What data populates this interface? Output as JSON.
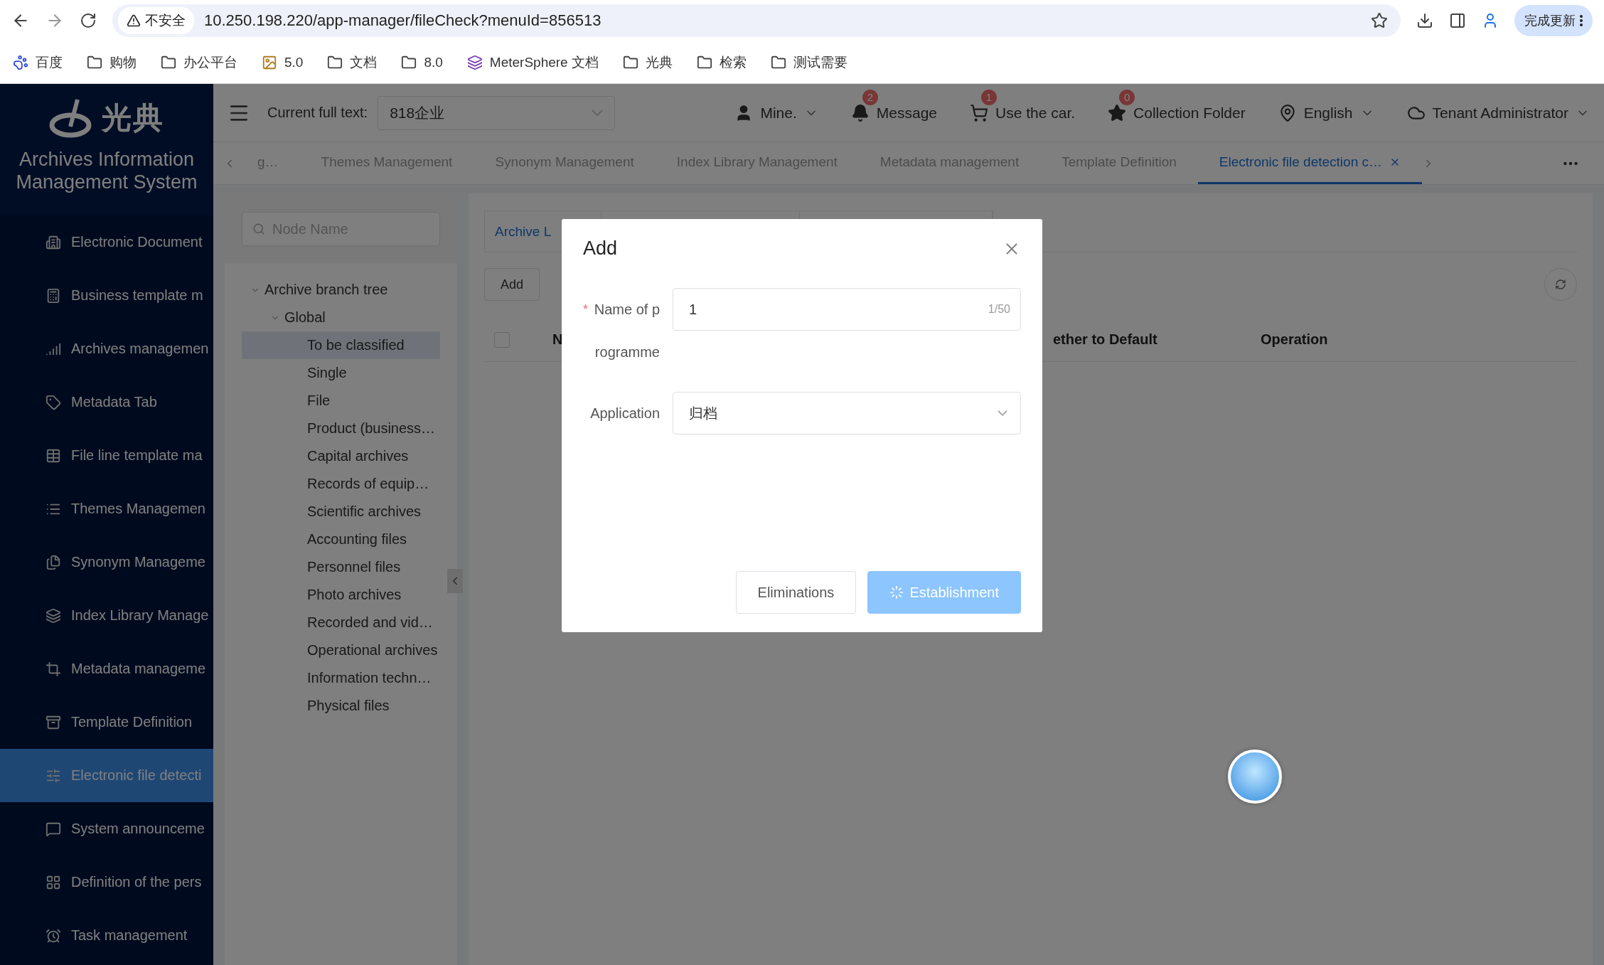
{
  "browser": {
    "security_label": "不安全",
    "url": "10.250.198.220/app-manager/fileCheck?menuId=856513",
    "update_button": "完成更新",
    "bookmarks": [
      {
        "kind": "paw",
        "label": "百度"
      },
      {
        "kind": "folder",
        "label": "购物"
      },
      {
        "kind": "folder",
        "label": "办公平台"
      },
      {
        "kind": "image",
        "label": "5.0"
      },
      {
        "kind": "folder",
        "label": "文档"
      },
      {
        "kind": "folder",
        "label": "8.0"
      },
      {
        "kind": "app",
        "label": "MeterSphere 文档"
      },
      {
        "kind": "folder",
        "label": "光典"
      },
      {
        "kind": "folder",
        "label": "检索"
      },
      {
        "kind": "folder",
        "label": "测试需要"
      }
    ]
  },
  "sidebar": {
    "logo_text": "光典",
    "system_title": "Archives Information Management System",
    "items": [
      {
        "label": "Electronic Document",
        "selected": false
      },
      {
        "label": "Business template m",
        "selected": false
      },
      {
        "label": "Archives managemen",
        "selected": false
      },
      {
        "label": "Metadata Tab",
        "selected": false
      },
      {
        "label": "File line template ma",
        "selected": false
      },
      {
        "label": "Themes Managemen",
        "selected": false
      },
      {
        "label": "Synonym Manageme",
        "selected": false
      },
      {
        "label": "Index Library Manage",
        "selected": false
      },
      {
        "label": "Metadata manageme",
        "selected": false
      },
      {
        "label": "Template Definition",
        "selected": false
      },
      {
        "label": "Electronic file detecti",
        "selected": true
      },
      {
        "label": "System announceme",
        "selected": false
      },
      {
        "label": "Definition of the pers",
        "selected": false
      },
      {
        "label": "Task management",
        "selected": false
      }
    ]
  },
  "header": {
    "full_text_label": "Current full text:",
    "company": "818企业",
    "items": [
      {
        "kind": "user",
        "label": "Mine.",
        "dropdown": true
      },
      {
        "kind": "bell",
        "label": "Message",
        "badge": "2"
      },
      {
        "kind": "cart",
        "label": "Use the car.",
        "badge": "1"
      },
      {
        "kind": "star",
        "label": "Collection Folder",
        "badge": "0"
      },
      {
        "kind": "pin",
        "label": "English",
        "dropdown": true
      },
      {
        "kind": "cloud",
        "label": "Tenant Administrator",
        "dropdown": true
      }
    ]
  },
  "tabs": [
    {
      "label": "g…",
      "selected": false,
      "closable": false
    },
    {
      "label": "Themes Management",
      "selected": false,
      "closable": false
    },
    {
      "label": "Synonym Management",
      "selected": false,
      "closable": false
    },
    {
      "label": "Index Library Management",
      "selected": false,
      "closable": false
    },
    {
      "label": "Metadata management",
      "selected": false,
      "closable": false
    },
    {
      "label": "Template Definition",
      "selected": false,
      "closable": false
    },
    {
      "label": "Electronic file detection c…",
      "selected": true,
      "closable": true
    }
  ],
  "tree": {
    "placeholder": "Node Name",
    "nodes": [
      {
        "label": "Archive branch tree",
        "expanded": true,
        "selected": false,
        "children": [
          {
            "label": "Global",
            "expanded": true,
            "selected": false,
            "children": [
              {
                "label": "To be classified",
                "selected": true
              },
              {
                "label": "Single",
                "selected": false
              },
              {
                "label": "File",
                "selected": false
              },
              {
                "label": "Product (business…",
                "selected": false
              },
              {
                "label": "Capital archives",
                "selected": false
              },
              {
                "label": "Records of equip…",
                "selected": false
              },
              {
                "label": "Scientific archives",
                "selected": false
              },
              {
                "label": "Accounting files",
                "selected": false
              },
              {
                "label": "Personnel files",
                "selected": false
              },
              {
                "label": "Photo archives",
                "selected": false
              },
              {
                "label": "Recorded and vid…",
                "selected": false
              },
              {
                "label": "Operational archives",
                "selected": false
              },
              {
                "label": "Information techn…",
                "selected": false
              },
              {
                "label": "Physical files",
                "selected": false
              }
            ]
          }
        ]
      }
    ]
  },
  "content": {
    "sub_tab": "Archive L",
    "add_button": "Add",
    "select_all_checked": false,
    "columns": [
      "N",
      "ether to Default",
      "Operation"
    ]
  },
  "modal": {
    "title": "Add",
    "fields": [
      {
        "kind": "input",
        "required_mark": "*",
        "label": "Name of programme",
        "value": "1",
        "counter": "1/50"
      },
      {
        "kind": "select",
        "label": "Application",
        "value": "归档"
      }
    ],
    "buttons": [
      {
        "kind": "plain",
        "label": "Eliminations"
      },
      {
        "kind": "primary",
        "label": "Establishment",
        "loading": true
      }
    ]
  }
}
